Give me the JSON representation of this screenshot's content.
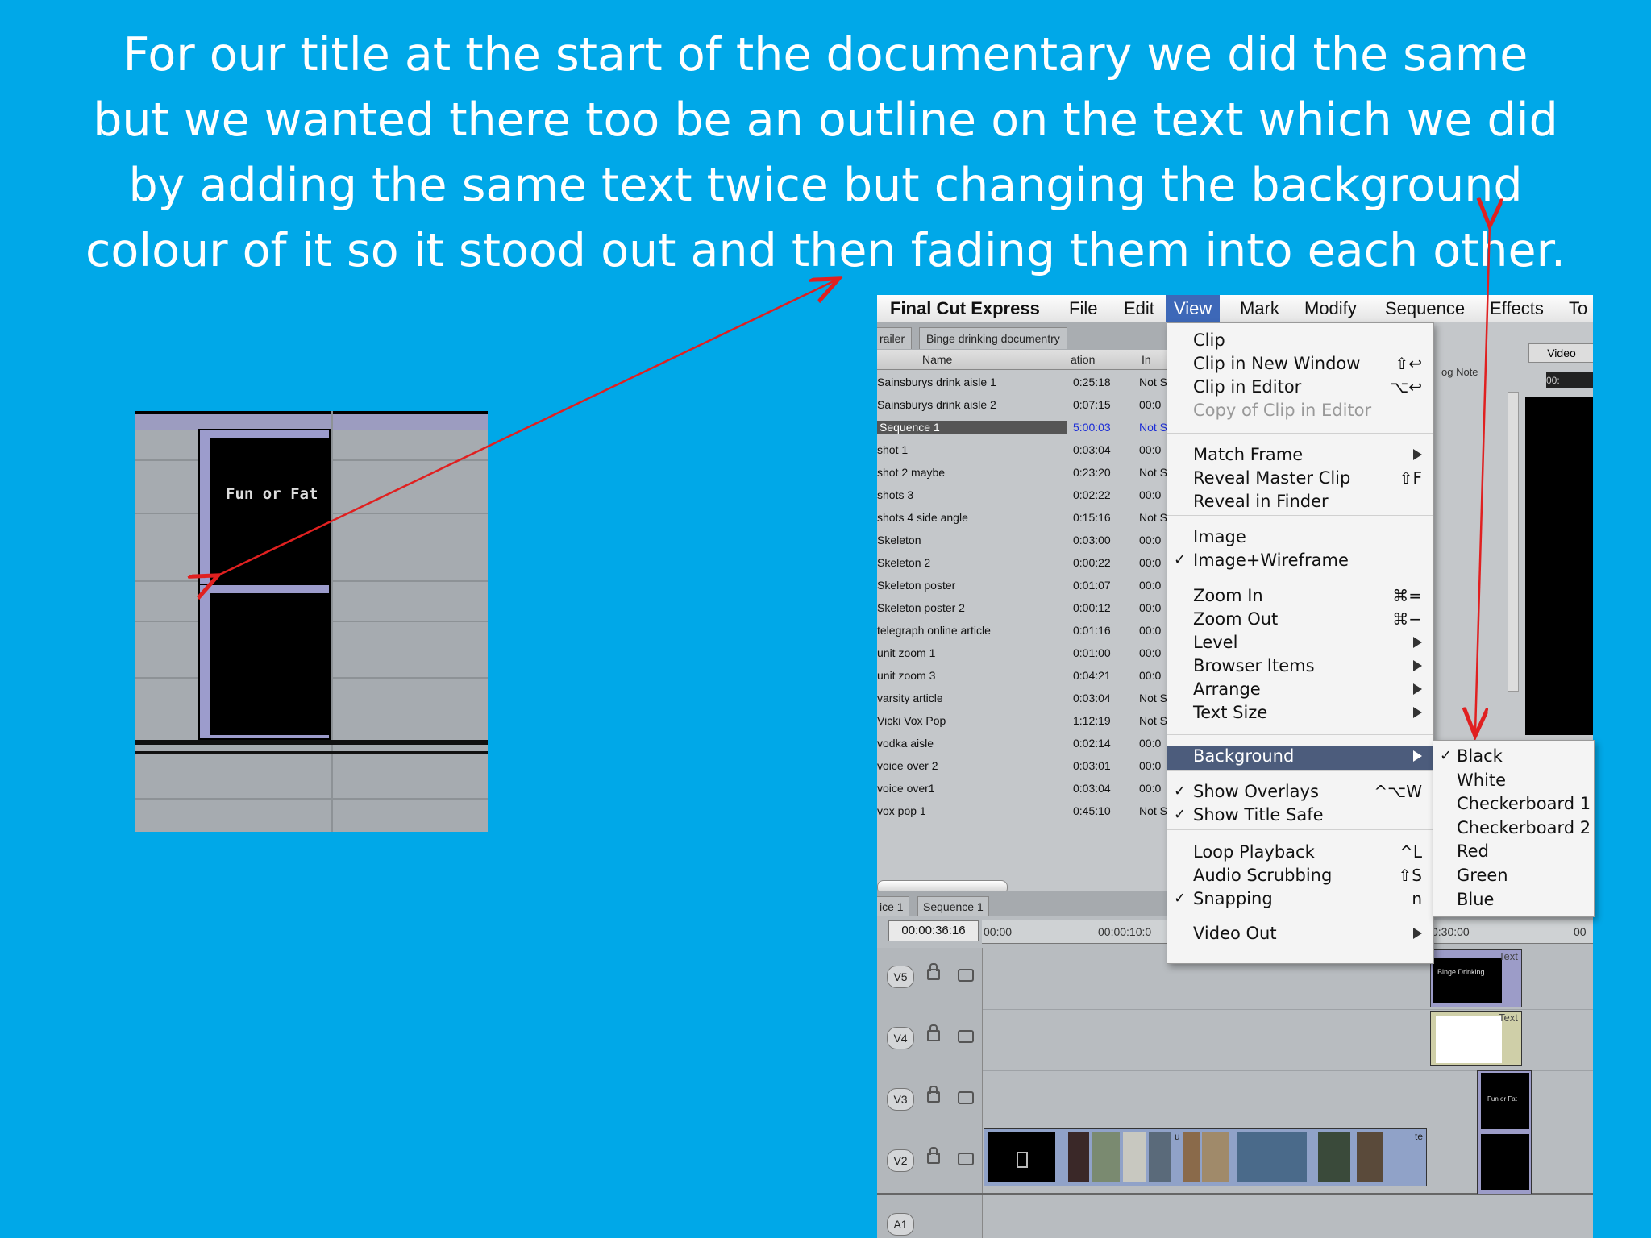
{
  "caption": "For our title at the start of the documentary we did the same but we wanted there too be an outline on the text which we did by adding the same text twice but changing the background colour of it so it stood out and then fading them into each other.",
  "zoom_inset": {
    "clip_text": "Fun or Fat"
  },
  "colors": {
    "slide_background": "#00a8e8",
    "arrow": "#e02020",
    "menu_highlight": "#4c5c7c"
  },
  "app": {
    "name": "Final Cut Express",
    "menus": [
      "File",
      "Edit",
      "View",
      "Mark",
      "Modify",
      "Sequence",
      "Effects",
      "To"
    ],
    "active_menu": "View"
  },
  "browser": {
    "tabs": [
      "railer",
      "Binge drinking documentry"
    ],
    "columns": {
      "name": "Name",
      "duration": "ation",
      "in": "In"
    },
    "log_note_header": "og Note",
    "rows": [
      {
        "name": "Sainsburys drink aisle 1",
        "duration": "0:25:18",
        "in": "Not S"
      },
      {
        "name": "Sainsburys drink aisle 2",
        "duration": "0:07:15",
        "in": "00:0"
      },
      {
        "name": "Sequence 1",
        "duration": "5:00:03",
        "in": "Not S",
        "selected": true
      },
      {
        "name": "shot 1",
        "duration": "0:03:04",
        "in": "00:0"
      },
      {
        "name": "shot 2 maybe",
        "duration": "0:23:20",
        "in": "Not S"
      },
      {
        "name": "shots 3",
        "duration": "0:02:22",
        "in": "00:0"
      },
      {
        "name": "shots 4 side angle",
        "duration": "0:15:16",
        "in": "Not S"
      },
      {
        "name": "Skeleton",
        "duration": "0:03:00",
        "in": "00:0"
      },
      {
        "name": "Skeleton 2",
        "duration": "0:00:22",
        "in": "00:0"
      },
      {
        "name": "Skeleton poster",
        "duration": "0:01:07",
        "in": "00:0"
      },
      {
        "name": "Skeleton poster 2",
        "duration": "0:00:12",
        "in": "00:0"
      },
      {
        "name": "telegraph online article",
        "duration": "0:01:16",
        "in": "00:0"
      },
      {
        "name": "unit zoom 1",
        "duration": "0:01:00",
        "in": "00:0"
      },
      {
        "name": "unit zoom 3",
        "duration": "0:04:21",
        "in": "00:0"
      },
      {
        "name": "varsity article",
        "duration": "0:03:04",
        "in": "Not S"
      },
      {
        "name": "Vicki Vox Pop",
        "duration": "1:12:19",
        "in": "Not S"
      },
      {
        "name": "vodka aisle",
        "duration": "0:02:14",
        "in": "00:0"
      },
      {
        "name": "voice over 2",
        "duration": "0:03:01",
        "in": "00:0"
      },
      {
        "name": "voice over1",
        "duration": "0:03:04",
        "in": "00:0"
      },
      {
        "name": "vox pop 1",
        "duration": "0:45:10",
        "in": "Not S"
      }
    ]
  },
  "viewer": {
    "tab": "Video",
    "timecode": "00:"
  },
  "view_menu": {
    "items": [
      {
        "label": "Clip",
        "shortcut": ""
      },
      {
        "label": "Clip in New Window",
        "shortcut": "⇧↩"
      },
      {
        "label": "Clip in Editor",
        "shortcut": "⌥↩"
      },
      {
        "label": "Copy of Clip in Editor",
        "shortcut": "",
        "disabled": true
      },
      {
        "label": "Match Frame",
        "submenu": true
      },
      {
        "label": "Reveal Master Clip",
        "shortcut": "⇧F"
      },
      {
        "label": "Reveal in Finder",
        "shortcut": ""
      },
      {
        "label": "Image",
        "shortcut": ""
      },
      {
        "label": "Image+Wireframe",
        "checked": true
      },
      {
        "label": "Zoom In",
        "shortcut": "⌘="
      },
      {
        "label": "Zoom Out",
        "shortcut": "⌘−"
      },
      {
        "label": "Level",
        "submenu": true
      },
      {
        "label": "Browser Items",
        "submenu": true
      },
      {
        "label": "Arrange",
        "submenu": true
      },
      {
        "label": "Text Size",
        "submenu": true
      },
      {
        "label": "Background",
        "submenu": true,
        "highlighted": true
      },
      {
        "label": "Show Overlays",
        "shortcut": "^⌥W",
        "checked": true
      },
      {
        "label": "Show Title Safe",
        "checked": true
      },
      {
        "label": "Loop Playback",
        "shortcut": "^L"
      },
      {
        "label": "Audio Scrubbing",
        "shortcut": "⇧S"
      },
      {
        "label": "Snapping",
        "shortcut": "n",
        "checked": true
      },
      {
        "label": "Video Out",
        "submenu": true
      }
    ],
    "check_mark": "✓"
  },
  "background_submenu": {
    "items": [
      {
        "label": "Black",
        "checked": true
      },
      {
        "label": "White"
      },
      {
        "label": "Checkerboard 1"
      },
      {
        "label": "Checkerboard 2"
      },
      {
        "label": "Red"
      },
      {
        "label": "Green"
      },
      {
        "label": "Blue"
      }
    ]
  },
  "timeline": {
    "tabs": [
      "ice 1",
      "Sequence 1"
    ],
    "timecode": "00:00:36:16",
    "ruler": [
      "00:00",
      "00:00:10:0",
      "0:30:00",
      "00"
    ],
    "tracks": [
      "V5",
      "V4",
      "V3",
      "V2",
      "A1"
    ],
    "clip_labels": {
      "text1": "Text",
      "text2": "Text",
      "binge": "Binge Drinking",
      "funorfat": "Fun or Fat",
      "u": "u",
      "te": "te"
    }
  }
}
